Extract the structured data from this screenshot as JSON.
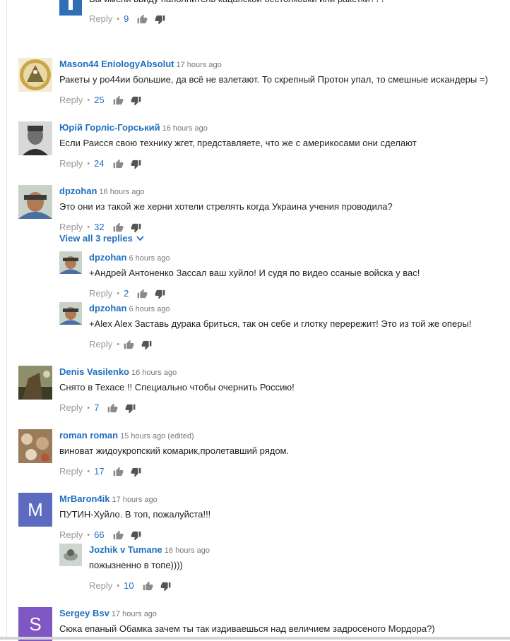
{
  "comments": [
    {
      "author": "",
      "time": "",
      "text": "Вы имели ввиду наполнитель кацапской бестолковки или ракетки???",
      "reply": "Reply",
      "likes": "9"
    },
    {
      "author": "Mason44 EniologyAbsolut",
      "time": "17 hours ago",
      "text": "Ракеты у ро44ии большие, да всё не взлетают. То скрепный Протон упал, то смешные искандеры =)",
      "reply": "Reply",
      "likes": "25"
    },
    {
      "author": "Юрій Горліс-Горський",
      "time": "16 hours ago",
      "text": "Если Раисся свою технику жгет, представляете, что же с америкосами они сделают",
      "reply": "Reply",
      "likes": "24"
    },
    {
      "author": "dpzohan",
      "time": "16 hours ago",
      "text": "Это они из такой же херни хотели стрелять когда Украина учения проводила?",
      "reply": "Reply",
      "likes": "32"
    },
    {
      "author": "Denis Vasilenko",
      "time": "16 hours ago",
      "text": "Снято в Техасе !! Специально чтобы очернить Россию!",
      "reply": "Reply",
      "likes": "7"
    },
    {
      "author": "roman roman",
      "time": "15 hours ago",
      "edited": "(edited)",
      "text": "виноват жидоукропский комарик,пролетавший рядом.",
      "reply": "Reply",
      "likes": "17"
    },
    {
      "author": "MrBaron4ik",
      "time": "17 hours ago",
      "avatar_letter": "M",
      "avatar_color": "#5c6bc0",
      "text": "ПУТИН-Хуйло. В топ, пожалуйста!!!",
      "reply": "Reply",
      "likes": "66"
    },
    {
      "author": "Sergey Bsv",
      "time": "17 hours ago",
      "avatar_letter": "S",
      "avatar_color": "#7e57c2",
      "text": "Сюка епаный Обамка зачем ты так издиваешься над величием задросеного Мордора?)"
    }
  ],
  "view_replies": "View all 3 replies",
  "replies": [
    {
      "author": "dpzohan",
      "time": "6 hours ago",
      "text": "+Андрей Антоненко Зассал ваш хуйло! И судя по видео ссаные войска у вас!",
      "reply": "Reply",
      "likes": "2"
    },
    {
      "author": "dpzohan",
      "time": "6 hours ago",
      "text": "+Alex Alex Заставь дурака бриться, так он себе и глотку перережит! Это из той же оперы!",
      "reply": "Reply",
      "likes": ""
    },
    {
      "author": "Jozhik v Tumane",
      "time": "16 hours ago",
      "text": "пожызненно в топе))))",
      "reply": "Reply",
      "likes": "10"
    }
  ],
  "icons": {
    "like": "thumbs-up-icon",
    "dislike": "thumbs-down-icon",
    "expand": "chevron-down-icon"
  },
  "colors": {
    "link": "#1f6fbf",
    "muted": "#999999"
  }
}
